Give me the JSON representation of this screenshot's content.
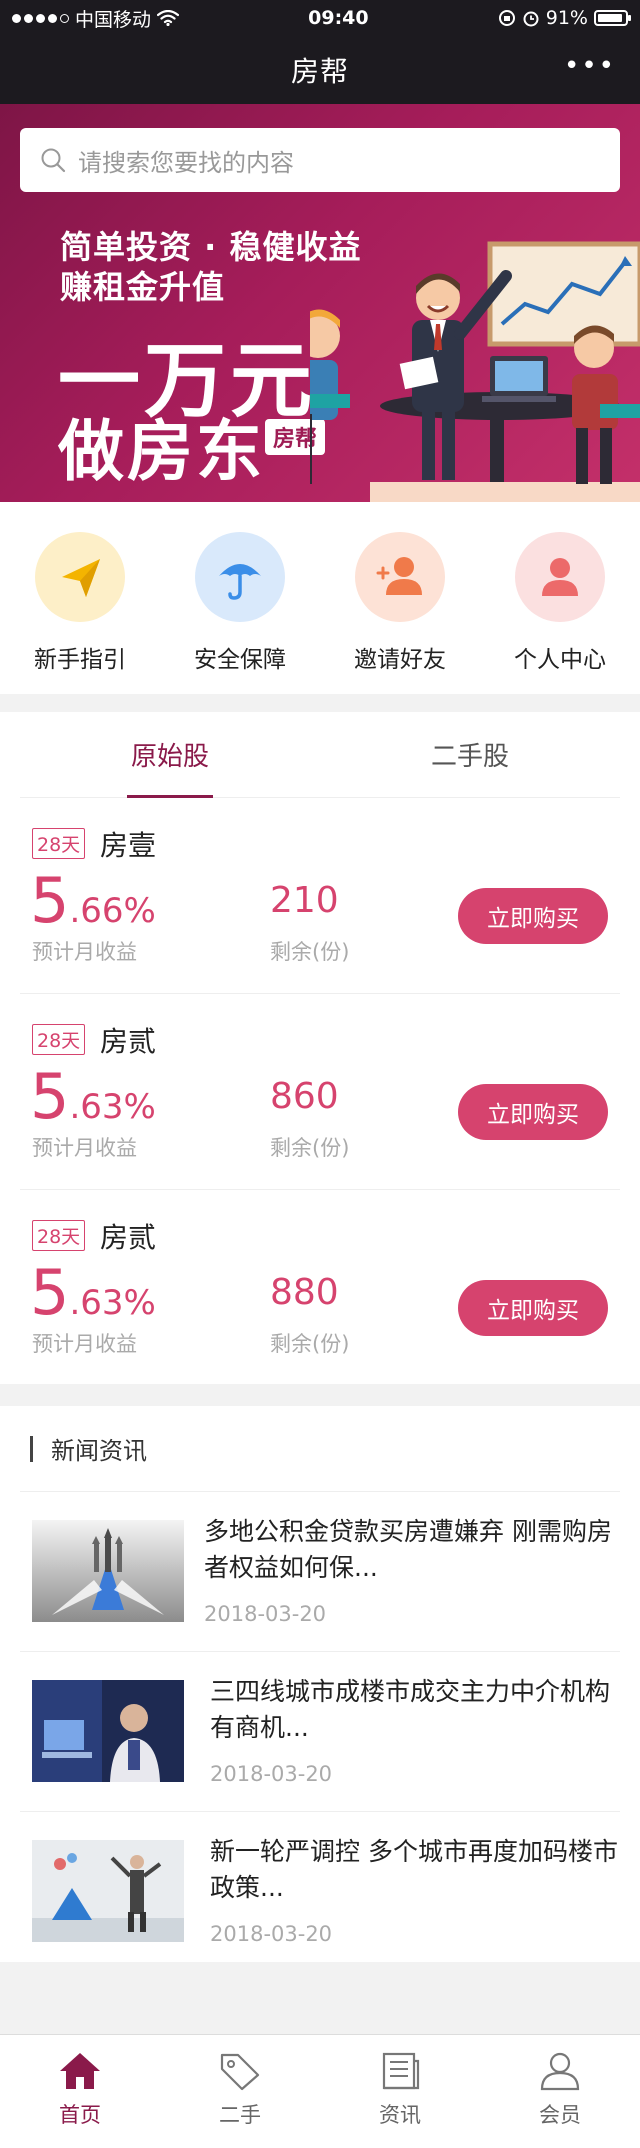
{
  "status_bar": {
    "carrier": "中国移动",
    "time": "09:40",
    "battery": "91%",
    "battery_level": 0.91
  },
  "nav": {
    "title": "房帮",
    "more_icon": "ellipsis-icon"
  },
  "search": {
    "placeholder": "请搜索您要找的内容",
    "icon": "search-icon"
  },
  "banner": {
    "line1": "简单投资 · 稳健收益",
    "line2": "赚租金升值",
    "headline1": "一万元",
    "headline2": "做房东",
    "tag": "房帮"
  },
  "quick_entries": [
    {
      "label": "新手指引",
      "icon": "paper-plane-icon",
      "bg": "#fdefc8",
      "fg": "#f4b400"
    },
    {
      "label": "安全保障",
      "icon": "umbrella-icon",
      "bg": "#d9e9fb",
      "fg": "#3b8ee8"
    },
    {
      "label": "邀请好友",
      "icon": "add-user-icon",
      "bg": "#fde2d6",
      "fg": "#f07a4a"
    },
    {
      "label": "个人中心",
      "icon": "user-icon",
      "bg": "#fbe0e0",
      "fg": "#ec6a6a"
    }
  ],
  "product_tabs": [
    "原始股",
    "二手股"
  ],
  "products": [
    {
      "days": "28天",
      "name": "房壹",
      "rate_int": "5",
      "rate_frac": ".66%",
      "rate_label": "预计月收益",
      "remain": "210",
      "remain_label": "剩余(份)",
      "buy": "立即购买"
    },
    {
      "days": "28天",
      "name": "房贰",
      "rate_int": "5",
      "rate_frac": ".63%",
      "rate_label": "预计月收益",
      "remain": "860",
      "remain_label": "剩余(份)",
      "buy": "立即购买"
    },
    {
      "days": "28天",
      "name": "房贰",
      "rate_int": "5",
      "rate_frac": ".63%",
      "rate_label": "预计月收益",
      "remain": "880",
      "remain_label": "剩余(份)",
      "buy": "立即购买"
    }
  ],
  "news": {
    "heading": "新闻资讯",
    "items": [
      {
        "title": "多地公积金贷款买房遭嫌弃 刚需购房者权益如何保...",
        "date": "2018-03-20"
      },
      {
        "title": "三四线城市成楼市成交主力中介机构有商机...",
        "date": "2018-03-20"
      },
      {
        "title": "新一轮严调控 多个城市再度加码楼市政策...",
        "date": "2018-03-20"
      }
    ]
  },
  "tabbar": [
    {
      "label": "首页",
      "icon": "home-icon",
      "active": true
    },
    {
      "label": "二手",
      "icon": "tag-icon",
      "active": false
    },
    {
      "label": "资讯",
      "icon": "news-icon",
      "active": false
    },
    {
      "label": "会员",
      "icon": "member-icon",
      "active": false
    }
  ],
  "colors": {
    "brand": "#8a1a4a",
    "accent": "#d6436e",
    "topbar": "#1c1a1f"
  }
}
